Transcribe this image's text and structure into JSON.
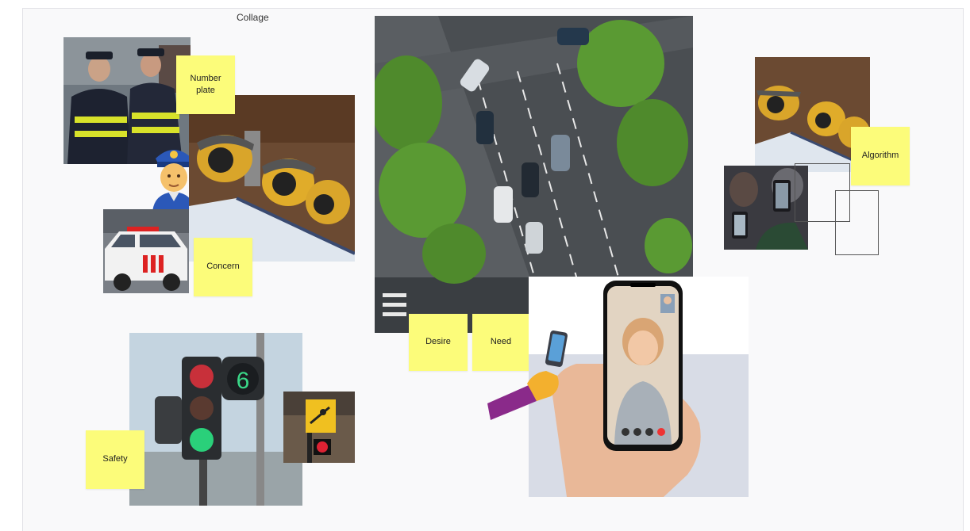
{
  "board": {
    "title": "Collage"
  },
  "stickies": {
    "number_plate": "Number plate",
    "concern": "Concern",
    "desire": "Desire",
    "need": "Need",
    "safety": "Safety",
    "algorithm": "Algorithm"
  },
  "colors": {
    "sticky": "#fcfc7a",
    "board_bg": "#f9f9fa"
  },
  "icons": [
    "police-officer-emoji-icon",
    "hand-holding-phone-icon"
  ],
  "phone_screen": {
    "controls": [
      "mute-icon",
      "camera-icon",
      "more-icon",
      "end-call-icon"
    ]
  }
}
